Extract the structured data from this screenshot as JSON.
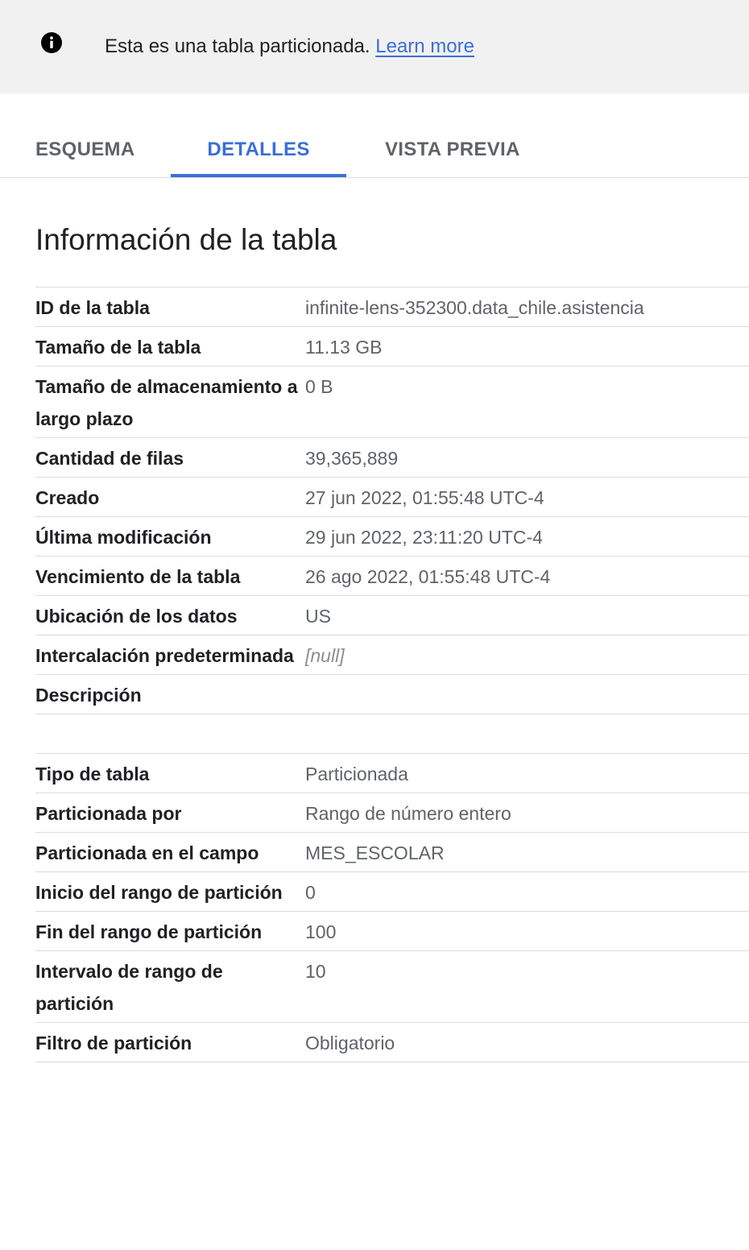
{
  "banner": {
    "text": "Esta es una tabla particionada.",
    "link": "Learn more",
    "icon": "info-icon"
  },
  "tabs": [
    {
      "label": "ESQUEMA",
      "active": false
    },
    {
      "label": "DETALLES",
      "active": true
    },
    {
      "label": "VISTA PREVIA",
      "active": false
    }
  ],
  "colors": {
    "accent": "#3a6fd8",
    "banner_bg": "#f1f1f1"
  },
  "section_title": "Información de la tabla",
  "table_info": [
    {
      "label": "ID de la tabla",
      "value": "infinite-lens-352300.data_chile.asistencia"
    },
    {
      "label": "Tamaño de la tabla",
      "value": "11.13 GB"
    },
    {
      "label": "Tamaño de almacenamiento a largo plazo",
      "value": "0 B"
    },
    {
      "label": "Cantidad de filas",
      "value": "39,365,889"
    },
    {
      "label": "Creado",
      "value": "27 jun 2022, 01:55:48 UTC-4"
    },
    {
      "label": "Última modificación",
      "value": "29 jun 2022, 23:11:20 UTC-4"
    },
    {
      "label": "Vencimiento de la tabla",
      "value": "26 ago 2022, 01:55:48 UTC-4"
    },
    {
      "label": "Ubicación de los datos",
      "value": "US"
    },
    {
      "label": "Intercalación predeterminada",
      "value": "[null]"
    },
    {
      "label": "Descripción",
      "value": ""
    }
  ],
  "partition_info": [
    {
      "label": "Tipo de tabla",
      "value": "Particionada"
    },
    {
      "label": "Particionada por",
      "value": "Rango de número entero"
    },
    {
      "label": "Particionada en el campo",
      "value": "MES_ESCOLAR"
    },
    {
      "label": "Inicio del rango de partición",
      "value": "0"
    },
    {
      "label": "Fin del rango de partición",
      "value": "100"
    },
    {
      "label": "Intervalo de rango de partición",
      "value": "10"
    },
    {
      "label": "Filtro de partición",
      "value": "Obligatorio"
    }
  ]
}
